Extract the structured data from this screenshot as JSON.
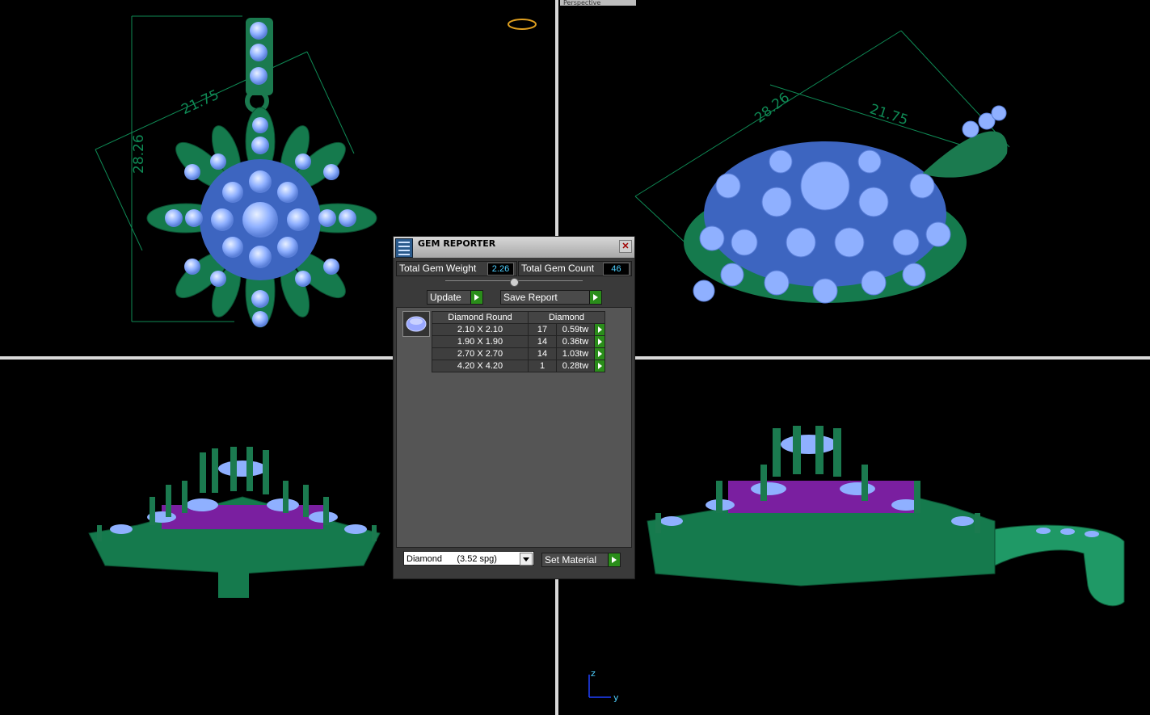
{
  "viewports": {
    "perspective_label": "Perspective",
    "top_dim_a": "21.75",
    "top_dim_b": "28.26",
    "persp_dim_a": "28.26",
    "persp_dim_b": "21.75",
    "axis_z": "z",
    "axis_y": "y"
  },
  "dialog": {
    "title": "GEM REPORTER",
    "close": "✕",
    "total_weight_label": "Total Gem Weight",
    "total_weight_value": "2.26",
    "total_count_label": "Total Gem Count",
    "total_count_value": "46",
    "update_label": "Update",
    "save_report_label": "Save Report",
    "table": {
      "headers": [
        "Diamond Round",
        "Diamond"
      ],
      "rows": [
        {
          "size": "2.10 X 2.10",
          "count": "17",
          "weight": "0.59tw"
        },
        {
          "size": "1.90 X 1.90",
          "count": "14",
          "weight": "0.36tw"
        },
        {
          "size": "2.70 X 2.70",
          "count": "14",
          "weight": "1.03tw"
        },
        {
          "size": "4.20 X 4.20",
          "count": "1",
          "weight": "0.28tw"
        }
      ]
    },
    "material_select": "Diamond      (3.52 spg)",
    "set_material_label": "Set Material"
  }
}
